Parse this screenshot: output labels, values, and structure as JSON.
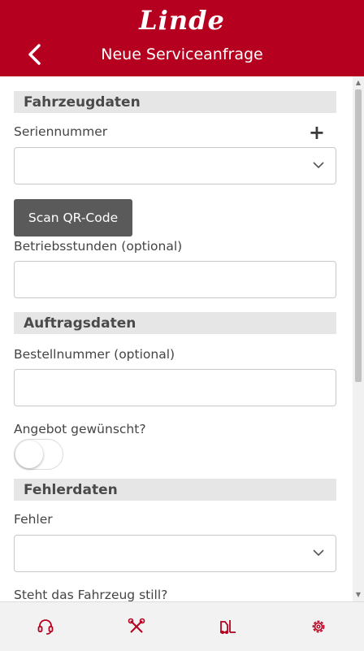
{
  "header": {
    "logo": "Linde",
    "title": "Neue Serviceanfrage"
  },
  "vehicle": {
    "section_title": "Fahrzeugdaten",
    "serial_label": "Seriennummer",
    "serial_value": "",
    "scan_button": "Scan QR-Code",
    "hours_label": "Betriebsstunden (optional)",
    "hours_value": ""
  },
  "order": {
    "section_title": "Auftragsdaten",
    "order_label": "Bestellnummer (optional)",
    "order_value": "",
    "quote_label": "Angebot gewünscht?",
    "quote_requested": false
  },
  "error": {
    "section_title": "Fehlerdaten",
    "error_label": "Fehler",
    "error_value": "",
    "stopped_label": "Steht das Fahrzeug still?"
  },
  "bottom_nav": [
    "headset-icon",
    "tools-icon",
    "forklift-icon",
    "gear-icon"
  ],
  "colors": {
    "brand_red": "#b5001f",
    "button_gray": "#5a5a5a",
    "section_bg": "#e6e6e6",
    "icon_red": "#b5001f"
  }
}
